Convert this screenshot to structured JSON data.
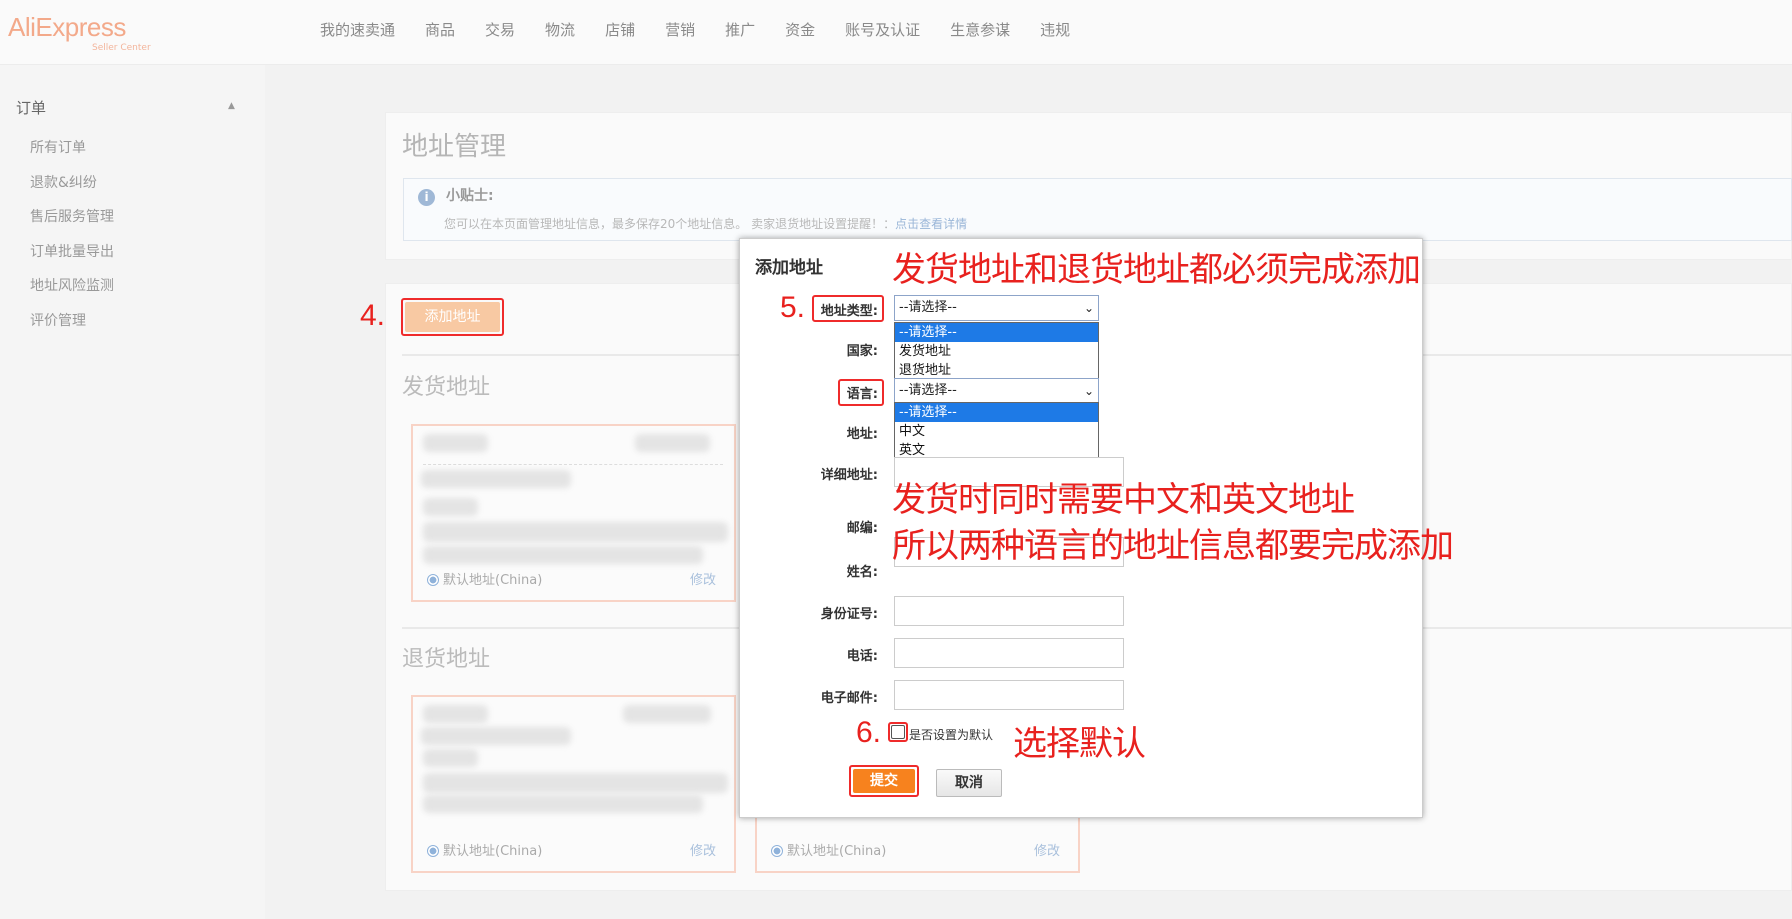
{
  "logo": {
    "name": "AliExpress",
    "sub": "Seller Center"
  },
  "nav": [
    "我的速卖通",
    "商品",
    "交易",
    "物流",
    "店铺",
    "营销",
    "推广",
    "资金",
    "账号及认证",
    "生意参谋",
    "违规"
  ],
  "sidebar": {
    "section": "订单",
    "items": [
      "所有订单",
      "退款&纠纷",
      "售后服务管理",
      "订单批量导出",
      "地址风险监测",
      "评价管理"
    ]
  },
  "page": {
    "title": "地址管理",
    "tip_icon": "i",
    "tip_title": "小贴士:",
    "tip_text": "您可以在本页面管理地址信息，最多保存20个地址信息。 卖家退货地址设置提醒！：",
    "tip_link": "点击查看详情",
    "add_button": "添加地址",
    "shipping_title": "发货地址",
    "return_title": "退货地址",
    "default_label": "默认地址(China)",
    "edit_label": "修改"
  },
  "dialog": {
    "title": "添加地址",
    "fields": {
      "type": "地址类型:",
      "country": "国家:",
      "language": "语言:",
      "address": "地址:",
      "detail": "详细地址:",
      "zip": "邮编:",
      "name": "姓名:",
      "id": "身份证号:",
      "phone": "电话:",
      "email": "电子邮件:"
    },
    "type_select": {
      "value": "--请选择--",
      "options": [
        "--请选择--",
        "发货地址",
        "退货地址"
      ]
    },
    "lang_select": {
      "value": "--请选择--",
      "options": [
        "--请选择--",
        "中文",
        "英文"
      ]
    },
    "default_checkbox": "是否设置为默认",
    "submit": "提交",
    "cancel": "取消"
  },
  "annotations": {
    "step4": "4.",
    "step5": "5.",
    "step6": "6.",
    "note1": "发货地址和退货地址都必须完成添加",
    "note2": "发货时同时需要中文和英文地址",
    "note3": "所以两种语言的地址信息都要完成添加",
    "note4": "选择默认"
  },
  "colors": {
    "accent": "#f7821e",
    "annotation": "#e8211e",
    "select_highlight": "#1e7ae6"
  }
}
